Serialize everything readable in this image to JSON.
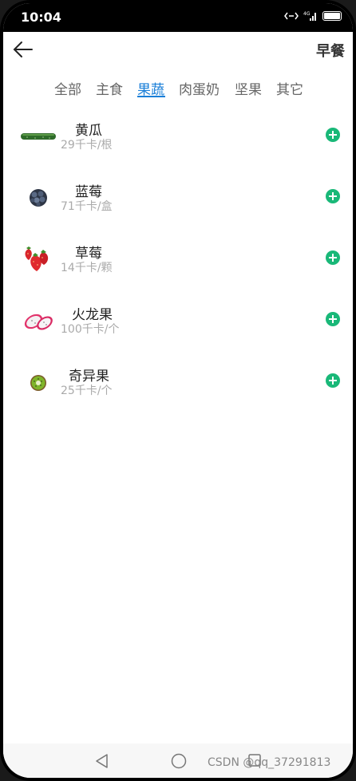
{
  "status_bar": {
    "time": "10:04",
    "signal_text": "⁴⁶ₐₗₗ"
  },
  "header": {
    "title": "早餐"
  },
  "tabs": [
    {
      "label": "全部",
      "active": false
    },
    {
      "label": "主食",
      "active": false
    },
    {
      "label": "果蔬",
      "active": true
    },
    {
      "label": "肉蛋奶",
      "active": false
    },
    {
      "label": "坚果",
      "active": false
    },
    {
      "label": "其它",
      "active": false
    }
  ],
  "foods": [
    {
      "name": "黄瓜",
      "calories": "29千卡/根",
      "icon": "cucumber-icon"
    },
    {
      "name": "蓝莓",
      "calories": "71千卡/盒",
      "icon": "blueberry-icon"
    },
    {
      "name": "草莓",
      "calories": "14千卡/颗",
      "icon": "strawberry-icon"
    },
    {
      "name": "火龙果",
      "calories": "100千卡/个",
      "icon": "dragonfruit-icon"
    },
    {
      "name": "奇异果",
      "calories": "25千卡/个",
      "icon": "kiwi-icon"
    }
  ],
  "watermark": "CSDN @qq_37291813",
  "colors": {
    "accent": "#1a7fd8",
    "add_button": "#19b878"
  }
}
